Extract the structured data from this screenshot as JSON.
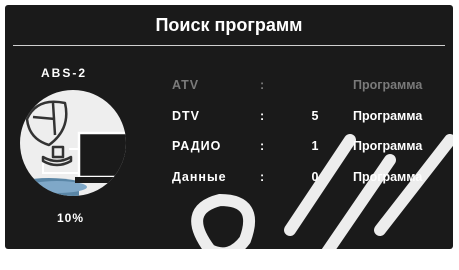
{
  "screen": {
    "title": "Поиск программ",
    "satellite": "ABS-2",
    "progress_text": "10%",
    "progress": 10,
    "icon": "satellite-dish-tv-icon"
  },
  "rows": [
    {
      "label": "ATV",
      "colon": ":",
      "count": "",
      "unit": "Программа",
      "active": false
    },
    {
      "label": "DTV",
      "colon": ":",
      "count": "5",
      "unit": "Программа",
      "active": true
    },
    {
      "label": "РАДИО",
      "colon": ":",
      "count": "1",
      "unit": "Программа",
      "active": true
    },
    {
      "label": "Данные",
      "colon": ":",
      "count": "0",
      "unit": "Программа",
      "active": true
    }
  ],
  "colors": {
    "panel": "#1a1a1a",
    "text_active": "#ffffff",
    "text_inactive": "#7a7a7a",
    "dish_circle": "#eeeeee"
  }
}
